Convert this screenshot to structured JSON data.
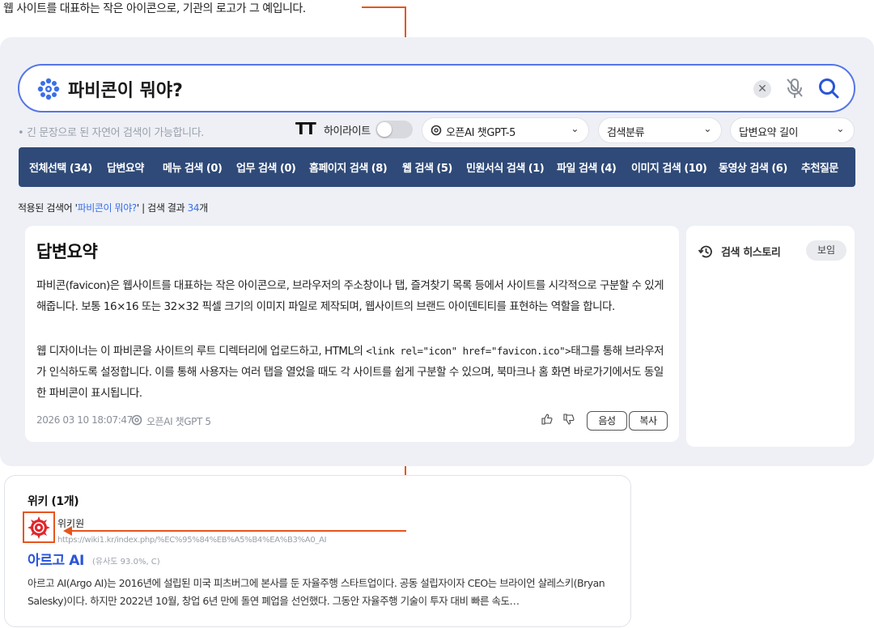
{
  "annotation": {
    "caption": "웹 사이트를 대표하는 작은 아이콘으로, 기관의 로고가 그 예입니다."
  },
  "search": {
    "query": "파비콘이 뭐야?",
    "clear_label": "✕"
  },
  "options": {
    "hint": "• 긴 문장으로 된 자연어 검색이 가능합니다.",
    "tt_icon": "TT",
    "highlight_label": "하이라이트",
    "highlight_on": false,
    "model_select": "오픈AI 챗GPT-5",
    "category_select": "검색분류",
    "length_select": "답변요약 길이",
    "chevron": "⌄"
  },
  "tabs": [
    "전체선택 (34)",
    "답변요약",
    "메뉴 검색 (0)",
    "업무 검색 (0)",
    "홈페이지 검색 (8)",
    "웹 검색 (5)",
    "민원서식 검색 (1)",
    "파일 검색 (4)",
    "이미지 검색 (10)",
    "동영상 검색 (6)",
    "추천질문"
  ],
  "applied": {
    "prefix": "적용된 검색어 '",
    "keyword": "파비콘이 뭐야?",
    "middle": "' | 검색 결과 ",
    "count": "34",
    "suffix": "개"
  },
  "answer": {
    "title": "답변요약",
    "p1": "파비콘(favicon)은 웹사이트를 대표하는 작은 아이콘으로, 브라우저의 주소창이나 탭, 즐겨찾기 목록 등에서 사이트를 시각적으로 구분할 수 있게 해줍니다. 보통 16×16 또는 32×32 픽셀 크기의 이미지 파일로 제작되며, 웹사이트의 브랜드 아이덴티티를 표현하는 역할을 합니다.",
    "p2_a": "웹 디자이너는 이 파비콘을 사이트의 루트 디렉터리에 업로드하고, HTML의 ",
    "p2_code": "<link rel=\"icon\" href=\"favicon.ico\">",
    "p2_b": "태그를 통해 브라우저가 인식하도록 설정합니다. 이를 통해 사용자는 여러 탭을 열었을 때도 각 사이트를 쉽게 구분할 수 있으며, 북마크나 홈 화면 바로가기에서도 동일한 파비콘이 표시됩니다.",
    "timestamp": "2026 03 10 18:07:47",
    "model": "오픈AI 챗GPT 5",
    "voice_label": "음성",
    "copy_label": "복사"
  },
  "history": {
    "title": "검색 히스토리",
    "show_label": "보임"
  },
  "result": {
    "section": "위키 (1개)",
    "source_name": "위키원",
    "source_url": "https://wiki1.kr/index.php/%EC%95%84%EB%A5%B4%EA%B3%A0_AI",
    "title": "아르고 AI",
    "similarity": "(유사도 93.0%, C)",
    "description": "아르고 AI(Argo AI)는 2016년에 설립된 미국 피츠버그에 본사를 둔 자율주행 스타트업이다. 공동 설립자이자 CEO는 브라이언 살레스키(Bryan Salesky)이다. 하지만 2022년 10월, 창업 6년 만에 돌연 폐업을 선언했다. 그동안 자율주행 기술이 투자 대비 빠른 속도…"
  },
  "colors": {
    "accent": "#5575e8",
    "tabbar": "#2f4a78",
    "annotation": "#e8541e",
    "link": "#2a55d8"
  }
}
